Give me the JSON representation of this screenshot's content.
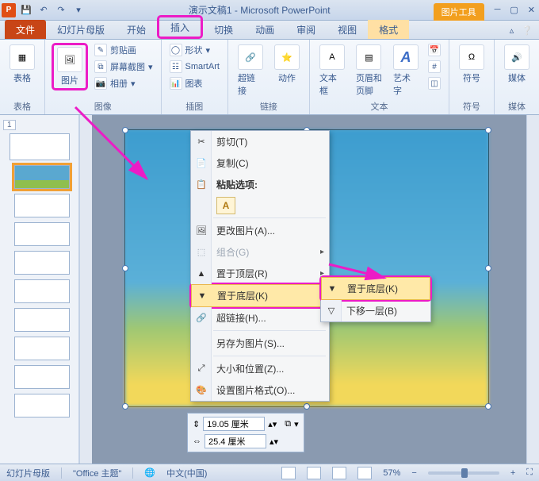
{
  "title": "演示文稿1 - Microsoft PowerPoint",
  "context_tool_label": "图片工具",
  "tabs": {
    "file": "文件",
    "slide_master": "幻灯片母版",
    "home": "开始",
    "insert": "插入",
    "transitions": "切换",
    "animations": "动画",
    "review": "审阅",
    "view": "视图",
    "format": "格式"
  },
  "ribbon": {
    "groups": {
      "tables": "表格",
      "images": "图像",
      "illustrations": "插图",
      "links": "链接",
      "text": "文本",
      "symbols": "符号",
      "media": "媒体"
    },
    "buttons": {
      "table": "表格",
      "picture": "图片",
      "clipart": "剪贴画",
      "screenshot": "屏幕截图",
      "album": "相册",
      "shapes": "形状",
      "smartart": "SmartArt",
      "chart": "图表",
      "hyperlink": "超链接",
      "action": "动作",
      "textbox": "文本框",
      "headerfooter": "页眉和页脚",
      "wordart": "艺术字",
      "symbol": "符号",
      "media": "媒体"
    }
  },
  "thumbs": {
    "badge": "1"
  },
  "context_menu": {
    "cut": "剪切(T)",
    "copy": "复制(C)",
    "paste_label": "粘贴选项:",
    "change_pic": "更改图片(A)...",
    "group": "组合(G)",
    "bring_front": "置于顶层(R)",
    "send_back": "置于底层(K)",
    "hyperlink": "超链接(H)...",
    "save_as_pic": "另存为图片(S)...",
    "size_pos": "大小和位置(Z)...",
    "format_pic": "设置图片格式(O)..."
  },
  "submenu": {
    "send_to_back": "置于底层(K)",
    "send_backward": "下移一层(B)"
  },
  "size_tool": {
    "height": "19.05 厘米",
    "width": "25.4 厘米"
  },
  "status": {
    "view": "幻灯片母版",
    "theme": "\"Office 主题\"",
    "lang": "中文(中国)",
    "zoom": "57%"
  }
}
